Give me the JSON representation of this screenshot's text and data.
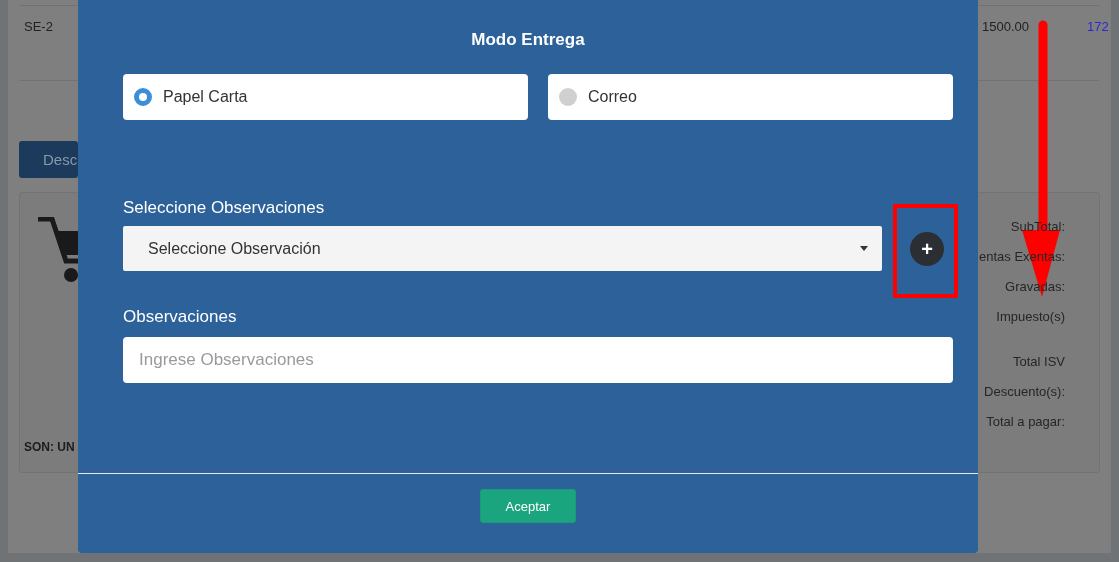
{
  "background": {
    "row": {
      "code": "SE-2",
      "amount": "1500.00",
      "column_3": "172"
    },
    "tab_button": "Desc",
    "amount_in_words": "SON: UN",
    "summary_groups": [
      [
        "SubTotal:",
        "entas Exentas:",
        "Gravadas:",
        "Impuesto(s)"
      ],
      [
        "Total ISV",
        "Descuento(s):",
        "Total a pagar:"
      ]
    ]
  },
  "modal": {
    "title": "Modo Entrega",
    "delivery_options": [
      {
        "label": "Papel Carta",
        "selected": true
      },
      {
        "label": "Correo",
        "selected": false
      }
    ],
    "observation_select": {
      "label": "Seleccione Observaciones",
      "value": "Seleccione Observación"
    },
    "add_button": "+",
    "observations": {
      "label": "Observaciones",
      "placeholder": "Ingrese Observaciones"
    },
    "buttons": [
      "Aceptar"
    ]
  }
}
